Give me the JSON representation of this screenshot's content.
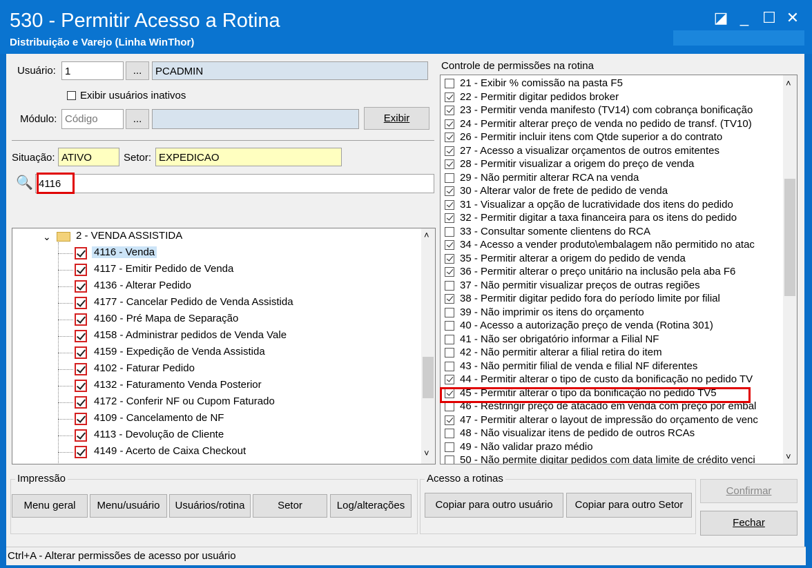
{
  "window": {
    "title": "530 - Permitir Acesso a Rotina",
    "subtitle": "Distribuição e Varejo (Linha WinThor)"
  },
  "user": {
    "label": "Usuário:",
    "code": "1",
    "browse": "...",
    "name": "PCADMIN",
    "show_inactive": "Exibir usuários inativos"
  },
  "module": {
    "label": "Módulo:",
    "placeholder": "Código",
    "browse": "...",
    "exibir": "Exibir"
  },
  "situacao": {
    "label": "Situação:",
    "value": "ATIVO"
  },
  "setor": {
    "label": "Setor:",
    "value": "EXPEDICAO"
  },
  "search": {
    "value": "4116"
  },
  "tree": {
    "folder": "2 - VENDA ASSISTIDA",
    "items": [
      "4116 - Venda",
      "4117 - Emitir Pedido de Venda",
      "4136 - Alterar Pedido",
      "4177 - Cancelar Pedido de Venda Assistida",
      "4160 - Pré Mapa de Separação",
      "4158 - Administrar pedidos de Venda Vale",
      "4159 - Expedição de Venda Assistida",
      "4102 - Faturar Pedido",
      "4132 - Faturamento Venda Posterior",
      "4172 - Conferir NF ou Cupom Faturado",
      "4109 - Cancelamento de NF",
      "4113 - Devolução de Cliente",
      "4149 - Acerto de Caixa Checkout"
    ]
  },
  "permissions": {
    "title": "Controle de permissões na rotina",
    "items": [
      {
        "label": "21 - Exibir % comissão na pasta F5",
        "checked": false
      },
      {
        "label": "22 - Permitir digitar pedidos broker",
        "checked": true
      },
      {
        "label": "23 - Permitir venda manifesto (TV14) com cobrança bonificação",
        "checked": true
      },
      {
        "label": "24 - Permitir alterar preço de venda no pedido de transf. (TV10)",
        "checked": true
      },
      {
        "label": "26 - Permitir incluir itens com Qtde superior a do contrato",
        "checked": true
      },
      {
        "label": "27 - Acesso a visualizar orçamentos de outros emitentes",
        "checked": true
      },
      {
        "label": "28 - Permitir visualizar a origem do preço de venda",
        "checked": true
      },
      {
        "label": "29 - Não permitir alterar RCA na venda",
        "checked": false
      },
      {
        "label": "30 - Alterar valor de frete de pedido de venda",
        "checked": true
      },
      {
        "label": "31 - Visualizar a opção de lucratividade dos itens do pedido",
        "checked": true
      },
      {
        "label": "32 - Permitir digitar a taxa financeira para os itens do pedido",
        "checked": true
      },
      {
        "label": "33 - Consultar somente clientens do RCA",
        "checked": false
      },
      {
        "label": "34 - Acesso a vender produto\\embalagem não permitido no atac",
        "checked": true
      },
      {
        "label": "35 - Permitir alterar a origem do pedido de venda",
        "checked": true
      },
      {
        "label": "36 - Permitir alterar o preço unitário na inclusão pela aba F6",
        "checked": true
      },
      {
        "label": "37 - Não permitir visualizar preços de outras regiões",
        "checked": false
      },
      {
        "label": "38 - Permitir digitar pedido fora do período limite por filial",
        "checked": true
      },
      {
        "label": "39 - Não imprimir os itens do orçamento",
        "checked": false
      },
      {
        "label": "40 - Acesso a autorização preço de venda (Rotina 301)",
        "checked": false
      },
      {
        "label": "41 - Não ser obrigatório informar a Filial NF",
        "checked": false
      },
      {
        "label": "42 - Não permitir alterar a filial retira do item",
        "checked": false
      },
      {
        "label": "43 - Não permitir filial de venda e filial NF diferentes",
        "checked": false
      },
      {
        "label": "44 - Permitir alterar o tipo de custo da bonificação no pedido TV",
        "checked": true
      },
      {
        "label": "45 - Permitir alterar o tipo da bonificação no pedido TV5",
        "checked": true
      },
      {
        "label": "46 - Restringir preço de atacado em venda com preço por embal",
        "checked": false
      },
      {
        "label": "47 - Permitir alterar o layout de impressão do orçamento de venc",
        "checked": true
      },
      {
        "label": "48 - Não visualizar itens de pedido de outros RCAs",
        "checked": false
      },
      {
        "label": "49 - Não validar prazo médio",
        "checked": false
      },
      {
        "label": "50 - Não permite digitar pedidos com data limite de crédito venci",
        "checked": false
      }
    ]
  },
  "impressao": {
    "title": "Impressão",
    "buttons": [
      "Menu geral",
      "Menu/usuário",
      "Usuários/rotina",
      "Setor",
      "Log/alterações"
    ]
  },
  "acesso": {
    "title": "Acesso a rotinas",
    "copy_user": "Copiar para outro usuário",
    "copy_setor": "Copiar para outro Setor"
  },
  "actions": {
    "confirm": "Confirmar",
    "close": "Fechar"
  },
  "status": "Ctrl+A - Alterar permissões de acesso por usuário"
}
